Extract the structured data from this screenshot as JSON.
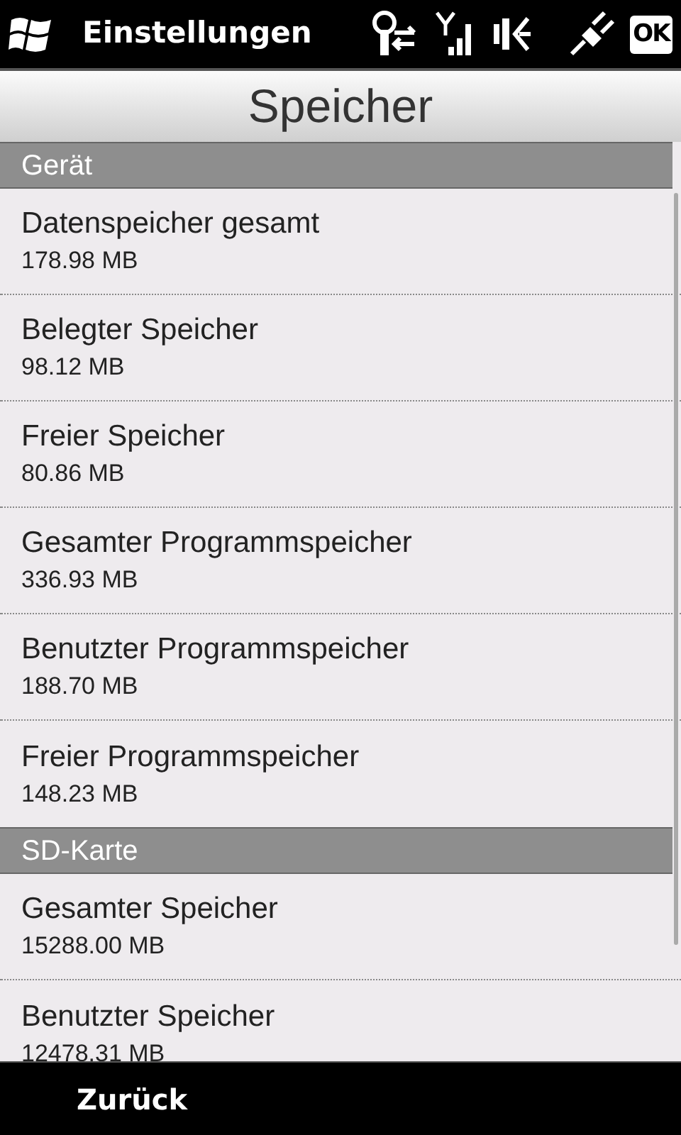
{
  "top_bar": {
    "title": "Einstellungen",
    "ok_button": "OK"
  },
  "header": {
    "title": "Speicher"
  },
  "sections": [
    {
      "label": "Gerät",
      "items": [
        {
          "label": "Datenspeicher gesamt",
          "value": "178.98 MB"
        },
        {
          "label": "Belegter Speicher",
          "value": "98.12 MB"
        },
        {
          "label": "Freier Speicher",
          "value": "80.86 MB"
        },
        {
          "label": "Gesamter Programmspeicher",
          "value": "336.93 MB"
        },
        {
          "label": "Benutzter Programmspeicher",
          "value": "188.70 MB"
        },
        {
          "label": "Freier Programmspeicher",
          "value": "148.23 MB"
        }
      ]
    },
    {
      "label": "SD-Karte",
      "items": [
        {
          "label": "Gesamter Speicher",
          "value": "15288.00 MB"
        },
        {
          "label": "Benutzter Speicher",
          "value": "12478.31 MB"
        }
      ]
    }
  ],
  "softkeys": {
    "left": "Zurück"
  }
}
